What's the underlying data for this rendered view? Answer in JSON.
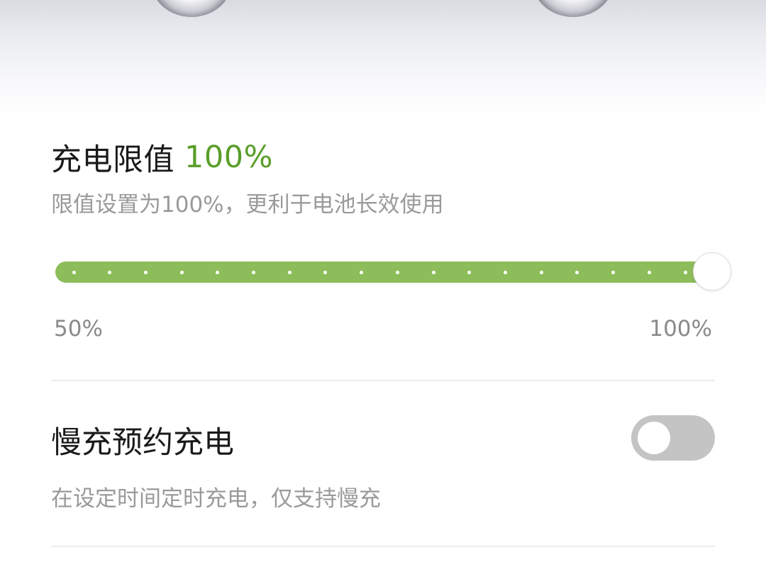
{
  "charge_limit": {
    "title": "充电限值",
    "value_text": "100%",
    "description": "限值设置为100%，更利于电池长效使用",
    "slider": {
      "min_label": "50%",
      "max_label": "100%",
      "min": 50,
      "max": 100,
      "step": 5,
      "value": 100
    }
  },
  "slow_charge_schedule": {
    "title": "慢充预约充电",
    "description": "在设定时间定时充电，仅支持慢充",
    "enabled": false
  },
  "colors": {
    "accent_green": "#5a9e2a",
    "slider_fill": "#8dbd5a",
    "toggle_off": "#c4c4c4"
  }
}
